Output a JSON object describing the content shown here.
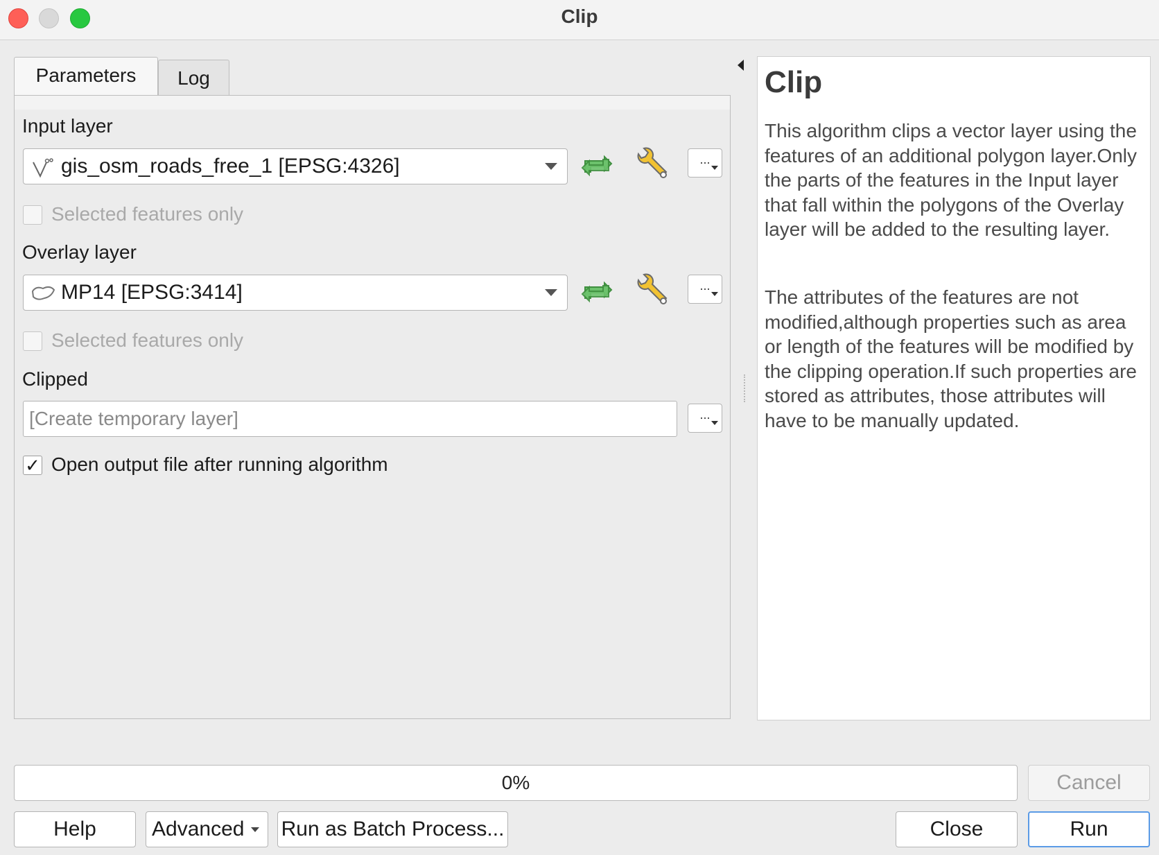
{
  "window": {
    "title": "Clip"
  },
  "tabs": [
    {
      "label": "Parameters",
      "active": true
    },
    {
      "label": "Log",
      "active": false
    }
  ],
  "params": {
    "input_layer": {
      "label": "Input layer",
      "value": "gis_osm_roads_free_1 [EPSG:4326]",
      "icon": "line-layer-icon",
      "selected_only_label": "Selected features only",
      "selected_only_checked": false
    },
    "overlay_layer": {
      "label": "Overlay layer",
      "value": "MP14 [EPSG:3414]",
      "icon": "polygon-layer-icon",
      "selected_only_label": "Selected features only",
      "selected_only_checked": false
    },
    "output": {
      "label": "Clipped",
      "placeholder": "[Create temporary layer]"
    },
    "open_output": {
      "label": "Open output file after running algorithm",
      "checked": true
    },
    "browse_label": "..."
  },
  "help": {
    "title": "Clip",
    "paragraphs": [
      "This algorithm clips a vector layer using the features of an additional polygon layer.Only the parts of the features in the Input layer that fall within the polygons of the Overlay layer will be added to the resulting layer.",
      "The attributes of the features are not modified,although properties such as area or length of the features will be modified by the clipping operation.If such properties are stored as attributes, those attributes will have to be manually updated."
    ]
  },
  "progress": {
    "value": 0,
    "label": "0%"
  },
  "buttons": {
    "cancel": "Cancel",
    "help": "Help",
    "advanced": "Advanced",
    "batch": "Run as Batch Process...",
    "close": "Close",
    "run": "Run"
  },
  "colors": {
    "accent": "#5b9be6",
    "iterate_green": "#5cb85c",
    "wrench_yellow": "#f1c232"
  }
}
